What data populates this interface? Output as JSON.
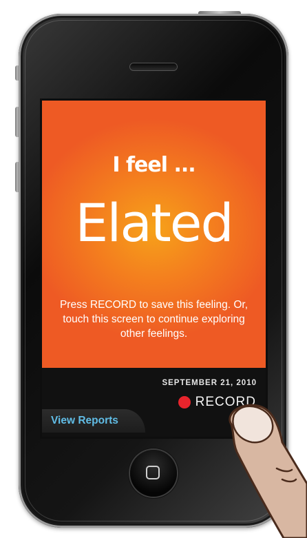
{
  "screen": {
    "prefix": "I feel ...",
    "feeling": "Elated",
    "instructions": "Press RECORD to save this feeling. Or, touch this screen to continue exploring other feelings.",
    "date": "SEPTEMBER 21, 2010",
    "record_label": "RECORD",
    "view_reports_label": "View Reports"
  },
  "colors": {
    "background_center": "#f6a21a",
    "background_edge": "#ee5a24",
    "record_dot": "#e8242c",
    "view_reports_text": "#61bde6"
  },
  "icons": {
    "record": "record-dot-icon",
    "home": "home-button-icon",
    "finger": "finger-illustration"
  }
}
